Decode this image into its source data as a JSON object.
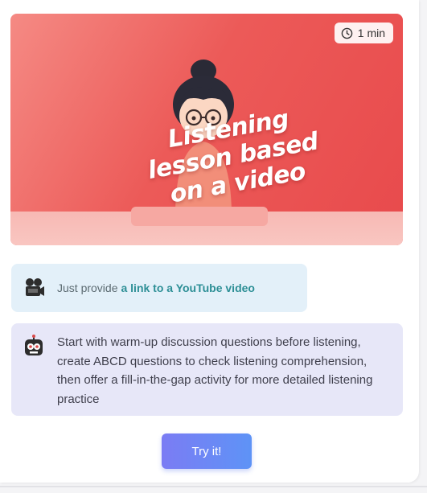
{
  "card": {
    "banner": {
      "duration": "1 min",
      "title_lines": [
        "Listening",
        "lesson based",
        "on a video"
      ],
      "clock_icon": "clock-icon",
      "colors": {
        "top": "#ec5a58",
        "floor": "#f9c6c1"
      }
    },
    "info_pill": {
      "icon": "film-camera-icon",
      "prefix": "Just provide",
      "link": "a link to a YouTube video"
    },
    "description": {
      "icon": "robot-icon",
      "text": "Start with warm-up discussion questions before listening, create ABCD questions to check listening comprehension, then offer a fill-in-the-gap activity for more detailed listening practice"
    },
    "cta": {
      "label": "Try it!"
    }
  }
}
